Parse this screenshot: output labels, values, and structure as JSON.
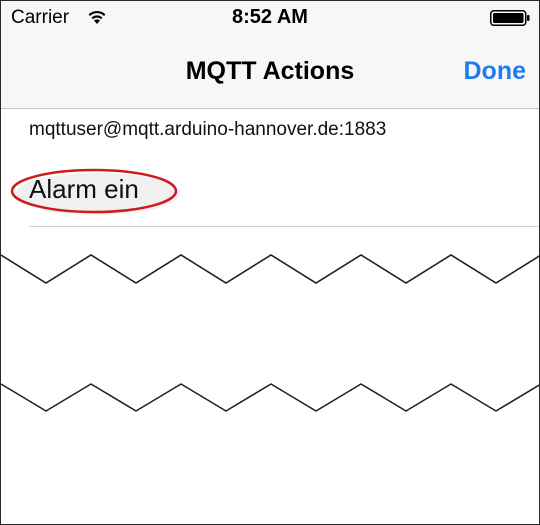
{
  "status_bar": {
    "carrier": "Carrier",
    "time": "8:52 AM"
  },
  "nav": {
    "title": "MQTT Actions",
    "done_label": "Done"
  },
  "connection": {
    "server": "mqttuser@mqtt.arduino-hannover.de:1883"
  },
  "actions": [
    {
      "label": "Alarm ein"
    }
  ],
  "colors": {
    "accent": "#1e7cf2",
    "highlight": "#cc1c1c",
    "bar_background": "#f7f7f7"
  }
}
